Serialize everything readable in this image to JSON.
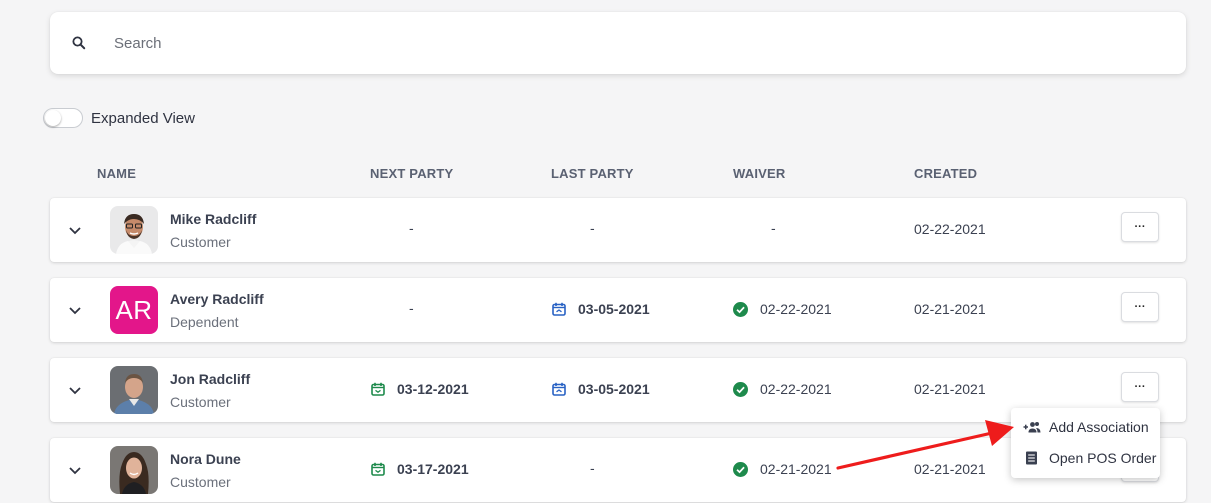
{
  "search": {
    "placeholder": "Search"
  },
  "toggle": {
    "label": "Expanded View",
    "on": false
  },
  "columns": {
    "name": "NAME",
    "next_party": "NEXT PARTY",
    "last_party": "LAST PARTY",
    "waiver": "WAIVER",
    "created": "CREATED"
  },
  "rows": [
    {
      "name": "Mike Radcliff",
      "role": "Customer",
      "next_party": "-",
      "last_party": "-",
      "waiver": "-",
      "created": "02-22-2021",
      "more": "···"
    },
    {
      "name": "Avery Radcliff",
      "role": "Dependent",
      "initials": "AR",
      "next_party": "-",
      "last_party": "03-05-2021",
      "waiver": "02-22-2021",
      "created": "02-21-2021",
      "more": "···"
    },
    {
      "name": "Jon Radcliff",
      "role": "Customer",
      "next_party": "03-12-2021",
      "last_party": "03-05-2021",
      "waiver": "02-22-2021",
      "created": "02-21-2021",
      "more": "···"
    },
    {
      "name": "Nora Dune",
      "role": "Customer",
      "next_party": "03-17-2021",
      "last_party": "-",
      "waiver": "02-21-2021",
      "created": "02-21-2021",
      "more": "···"
    }
  ],
  "menu": {
    "add_association": "Add Association",
    "open_pos_order": "Open POS Order"
  },
  "colors": {
    "accent_green": "#1e8a4c",
    "accent_blue": "#2962c4",
    "avatar_pink": "#e3168a",
    "arrow_red": "#ee1c1c"
  }
}
